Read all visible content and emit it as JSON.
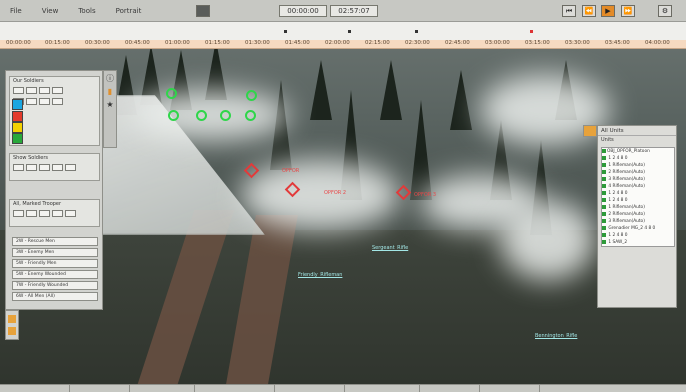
{
  "menu": {
    "items": [
      "File",
      "View",
      "Tools",
      "Portrait"
    ]
  },
  "playback": {
    "current_time": "00:00:00",
    "end_time": "02:57:07"
  },
  "timeline": {
    "ticks": [
      "00:00:00",
      "00:15:00",
      "00:30:00",
      "00:45:00",
      "01:00:00",
      "01:15:00",
      "01:30:00",
      "01:45:00",
      "02:00:00",
      "02:15:00",
      "02:30:00",
      "02:45:00",
      "03:00:00",
      "03:15:00",
      "03:30:00",
      "03:45:00",
      "04:00:00"
    ]
  },
  "left_panel": {
    "section1_title": "Our Soldiers",
    "section2_title": "Show Soldiers",
    "section3_title": "All, Marked Trooper",
    "list_items": [
      "2W - Rescue Men",
      "3W - Enemy Men",
      "5W - Friendly Men",
      "5W - Enemy Wounded",
      "7W - Friendly Wounded",
      "6W - All Men (All)"
    ],
    "colors": [
      "#1aa6e0",
      "#e33b2c",
      "#f3d000",
      "#28a83b"
    ]
  },
  "right_panel": {
    "title": "All Units",
    "subtitle": "Units",
    "tree": [
      "OBJ_OPFOR_Platoon",
      "  1 2 4 8 0",
      "  1 Rifleman(Auto)",
      "  2 Rifleman(Auto)",
      "  3 Rifleman(Auto)",
      "  4 Rifleman(Auto)",
      "  1 2 4 8 0",
      "  1 2 4 8 0",
      "  1 Rifleman(Auto)",
      "  2 Rifleman(Auto)",
      "  3 Rifleman(Auto)",
      "  Grenadier MG_2 4 8 0",
      "  1 2 4 8 0",
      "  1 SAW_2",
      "  1 2 4 8 0"
    ]
  },
  "hud": {
    "enemy_labels": [
      "OPFOR",
      "OPFOR 2",
      "OPFOR 3"
    ],
    "friendly_labels": [
      "Friendly_Rifleman",
      "Sergeant_Rifle",
      "Bennington_Rifle"
    ]
  },
  "status": {
    "cells": [
      "",
      "",
      "",
      "",
      "",
      "",
      "",
      ""
    ]
  }
}
